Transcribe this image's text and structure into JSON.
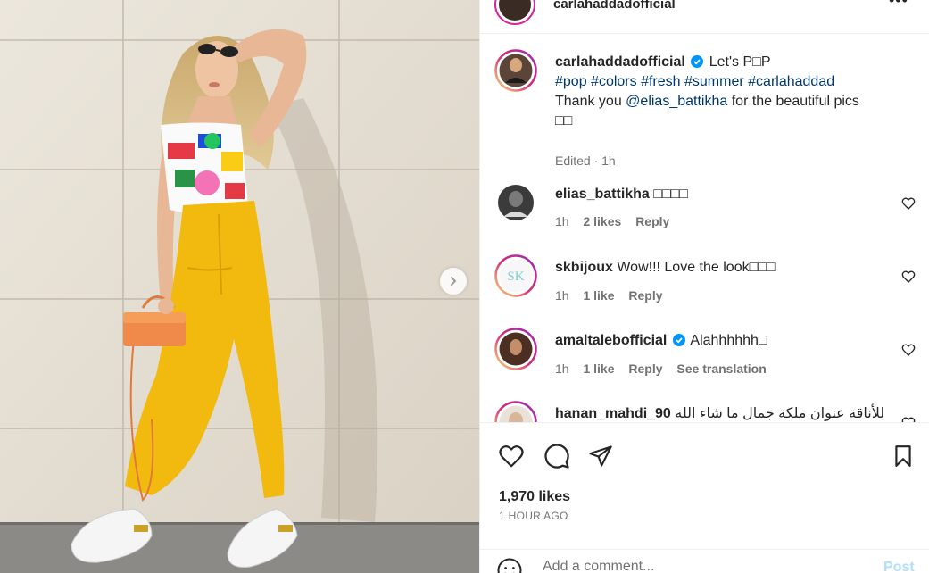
{
  "post": {
    "username": "carlahaddadofficial",
    "caption": {
      "text": "Let's P□P",
      "hashtags": [
        "#pop",
        "#colors",
        "#fresh",
        "#summer",
        "#carlahaddad"
      ],
      "thanks_prefix": "Thank you",
      "mention": "@elias_battikha",
      "thanks_suffix": "for the beautiful pics",
      "emojis": "□□",
      "meta": "Edited · 1h"
    },
    "likes": "1,970 likes",
    "time_ago": "1 HOUR AGO"
  },
  "comments": [
    {
      "username": "elias_battikha",
      "text": "□□□□",
      "time": "1h",
      "likes": "2 likes",
      "reply": "Reply"
    },
    {
      "username": "skbijoux",
      "text": "Wow!!! Love the look□□□",
      "time": "1h",
      "likes": "1 like",
      "reply": "Reply",
      "avatar_text": "SK"
    },
    {
      "username": "amaltalebofficial",
      "text": "Alahhhhhh□",
      "time": "1h",
      "likes": "1 like",
      "reply": "Reply",
      "translate": "See translation"
    },
    {
      "username": "hanan_mahdi_90",
      "text": "للأناقة عنوان ملكة جمال ما شاء الله"
    }
  ],
  "composer": {
    "placeholder": "Add a comment...",
    "post_label": "Post"
  },
  "icons": {
    "like": "heart-icon",
    "comment": "comment-icon",
    "share": "share-icon",
    "save": "bookmark-icon",
    "more": "more-options-icon",
    "emoji": "emoji-icon",
    "next": "chevron-right-icon",
    "verified": "verified-badge-icon"
  },
  "colors": {
    "link": "#00376b",
    "verified": "#0095f6",
    "muted": "#737373",
    "post_disabled": "#b2dffc",
    "story_ring": "#d6249f"
  }
}
